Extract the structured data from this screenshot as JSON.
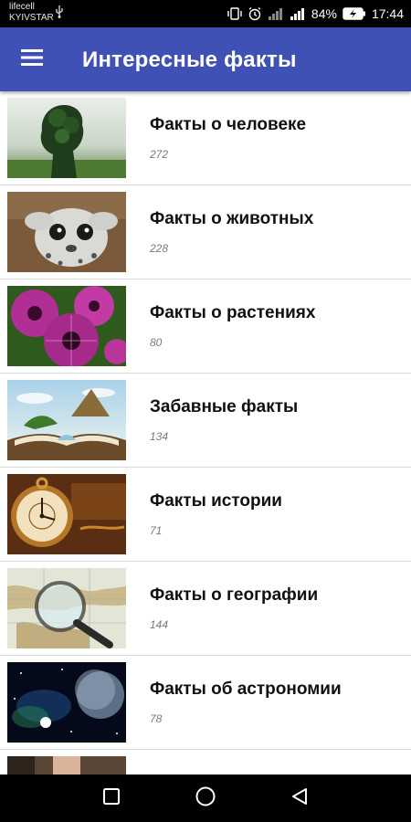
{
  "status_bar": {
    "carrier_1": "lifecell",
    "carrier_2": "KYIVSTAR",
    "battery": "84%",
    "time": "17:44"
  },
  "app_bar": {
    "title": "Интересные факты",
    "menu_icon": "hamburger-menu-icon"
  },
  "categories": [
    {
      "title": "Факты о человеке",
      "count": "272",
      "image": "human-silhouette-tree"
    },
    {
      "title": "Факты о животных",
      "count": "228",
      "image": "snow-leopard-cub"
    },
    {
      "title": "Факты о растениях",
      "count": "80",
      "image": "purple-petunia-flowers"
    },
    {
      "title": "Забавные факты",
      "count": "134",
      "image": "fantasy-open-book-landscape"
    },
    {
      "title": "Факты истории",
      "count": "71",
      "image": "antique-pocket-watch"
    },
    {
      "title": "Факты о географии",
      "count": "144",
      "image": "magnifier-over-map"
    },
    {
      "title": "Факты об астрономии",
      "count": "78",
      "image": "planets-in-space"
    }
  ],
  "nav_bar": {
    "buttons": [
      "recents-square-icon",
      "home-circle-icon",
      "back-triangle-icon"
    ]
  }
}
